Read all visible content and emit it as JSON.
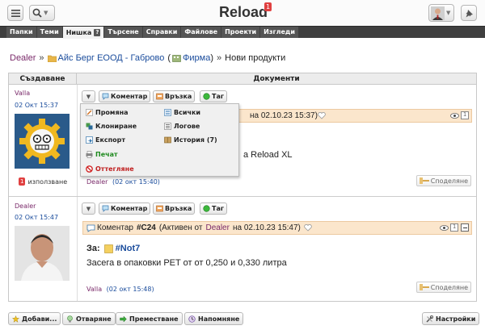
{
  "app": {
    "title": "Reload",
    "notification_count": "1"
  },
  "nav": {
    "tabs": [
      {
        "label": "Папки"
      },
      {
        "label": "Теми"
      },
      {
        "label": "Нишка",
        "active": true,
        "help": "?"
      },
      {
        "label": "Търсене"
      },
      {
        "label": "Справки"
      },
      {
        "label": "Файлове"
      },
      {
        "label": "Проекти"
      },
      {
        "label": "Изгледи"
      }
    ]
  },
  "breadcrumb": {
    "user": "Dealer",
    "sep": "»",
    "company": "Айс Берг ЕООД - Габрово",
    "paren_open": "(",
    "company_type": "Фирма",
    "paren_close": ")",
    "current": "Нови продукти"
  },
  "table": {
    "col_created": "Създаване",
    "col_documents": "Документи"
  },
  "rows": [
    {
      "author": "Valla",
      "date": "02 Окт 15:37",
      "usage_count": "1",
      "usage_label": "използване",
      "toolbar": {
        "comment": "Коментар",
        "link": "Връзка",
        "tag": "Таг"
      },
      "comment_tail": "на 02.10.23 15:37)",
      "body_tail": "а Reload XL",
      "footer_author": "Dealer",
      "footer_date": "(02 окт 15:40)",
      "share_label": "Споделяне"
    },
    {
      "author": "Dealer",
      "date": "02 Окт 15:47",
      "toolbar": {
        "comment": "Коментар",
        "link": "Връзка",
        "tag": "Таг"
      },
      "comment_label": "Коментар",
      "comment_id": "#C24",
      "comment_status_pre": "(Активен от",
      "comment_author": "Dealer",
      "comment_status_post": "на 02.10.23 15:47)",
      "views": "1",
      "subject_label": "За:",
      "subject_tag": "#Not7",
      "body": "Засега в опаковки PET от от 0,250 и 0,330 литра",
      "footer_author": "Valla",
      "footer_date": "(02 окт 15:48)",
      "share_label": "Споделяне"
    }
  ],
  "dropdown": {
    "left": [
      {
        "label": "Промяна",
        "icon": "pencil-icon"
      },
      {
        "label": "Клониране",
        "icon": "clone-icon"
      },
      {
        "label": "Експорт",
        "icon": "export-icon"
      },
      {
        "label": "Печат",
        "icon": "print-icon",
        "color": "#1f8a1f"
      },
      {
        "label": "Оттегляне",
        "icon": "revoke-icon",
        "color": "#c02020"
      }
    ],
    "right": [
      {
        "label": "Всички",
        "icon": "list-icon"
      },
      {
        "label": "Логове",
        "icon": "log-icon"
      },
      {
        "label": "История (7)",
        "icon": "history-icon"
      }
    ]
  },
  "bottom": {
    "add": "Добави...",
    "open": "Отваряне",
    "move": "Преместване",
    "remind": "Напомняне",
    "settings": "Настройки"
  },
  "colors": {
    "accent_purple": "#7a2a6a",
    "link_blue": "#1a4c9c",
    "comment_bg": "#fbe6cc",
    "nav_bg": "#3f3f3f",
    "badge_red": "#e04040"
  }
}
